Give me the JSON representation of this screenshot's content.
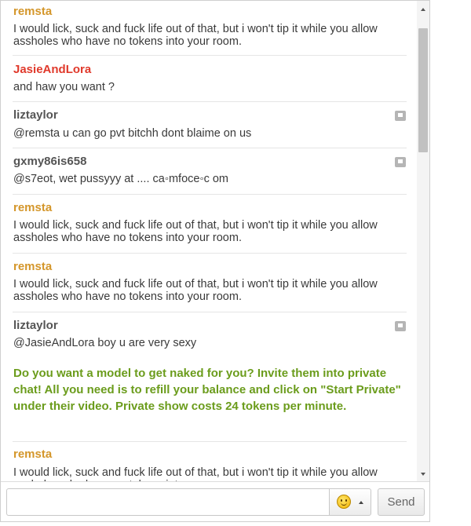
{
  "colors": {
    "user_gold": "#d4962a",
    "user_red": "#e0392b",
    "user_gray": "#555555",
    "promo_green": "#6b9c1c",
    "message_text": "#3a3a3a"
  },
  "messages": [
    {
      "user": "remsta",
      "text": "I would lick, suck and fuck life out of that, but i won't tip it while you allow assholes who have no tokens into your room.",
      "user_color": "#d4962a",
      "report_icon": false
    },
    {
      "user": "JasieAndLora",
      "text": "and haw you want ?",
      "user_color": "#e0392b",
      "report_icon": false
    },
    {
      "user": "liztaylor",
      "text": "@remsta u can go pvt bitchh dont blaime on us",
      "user_color": "#555555",
      "report_icon": true
    },
    {
      "user": "gxmy86is658",
      "text": "@s7eot, wet pussyyy at .... ca◦mfoce◦c om",
      "user_color": "#555555",
      "report_icon": true
    },
    {
      "user": "remsta",
      "text": "I would lick, suck and fuck life out of that, but i won't tip it while you allow assholes who have no tokens into your room.",
      "user_color": "#d4962a",
      "report_icon": false
    },
    {
      "user": "remsta",
      "text": "I would lick, suck and fuck life out of that, but i won't tip it while you allow assholes who have no tokens into your room.",
      "user_color": "#d4962a",
      "report_icon": false
    },
    {
      "user": "liztaylor",
      "text": "@JasieAndLora boy u are very sexy",
      "user_color": "#555555",
      "report_icon": true
    },
    {
      "user": "remsta",
      "text": "I would lick, suck and fuck life out of that, but i won't tip it while you allow assholes who have no tokens into your room.",
      "user_color": "#d4962a",
      "report_icon": false
    }
  ],
  "promo": {
    "text": "Do you want a model to get naked for you? Invite them into private chat! All you need is to refill your balance and click on \"Start Private\" under their video. Private show costs 24 tokens per minute."
  },
  "input": {
    "value": "",
    "placeholder": ""
  },
  "emoji_button": {
    "icon": "smiley-icon",
    "caret": "caret-up-icon"
  },
  "send_button": {
    "label": "Send"
  }
}
